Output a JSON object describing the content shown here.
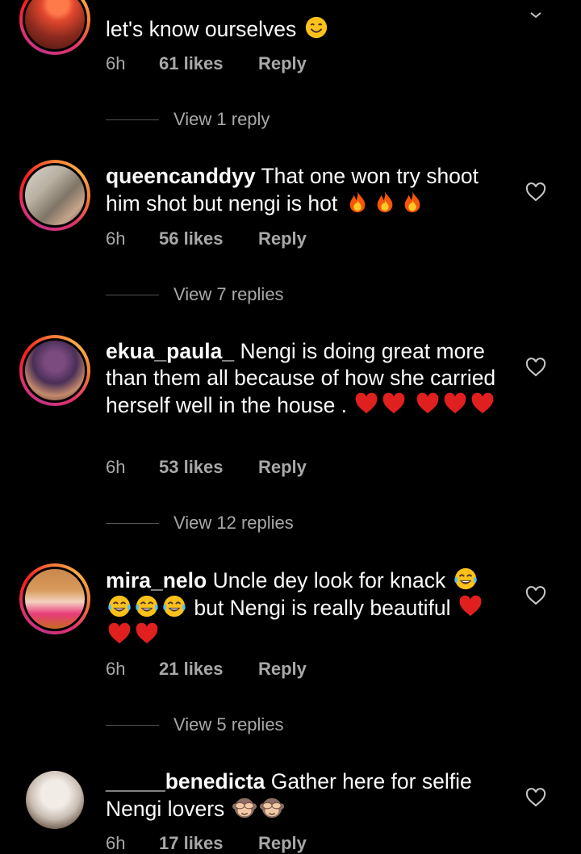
{
  "comments": [
    {
      "user": "",
      "text": "let's know ourselves",
      "emojis": [
        "smiling-face"
      ],
      "time": "6h",
      "likes": "61 likes",
      "reply": "Reply",
      "view_replies": "View 1 reply"
    },
    {
      "user": "queencanddyy",
      "text": "That one won try shoot him shot but nengi is hot",
      "emojis": [
        "fire",
        "fire",
        "fire"
      ],
      "time": "6h",
      "likes": "56 likes",
      "reply": "Reply",
      "view_replies": "View 7 replies"
    },
    {
      "user": "ekua_paula_",
      "text": "Nengi is doing great more than them all because of how she carried herself well in the house .",
      "emojis": [
        "red-heart",
        "red-heart",
        "red-heart",
        "red-heart",
        "red-heart"
      ],
      "time": "6h",
      "likes": "53 likes",
      "reply": "Reply",
      "view_replies": "View 12 replies"
    },
    {
      "user": "mira_nelo",
      "text_a": "Uncle dey look for knack",
      "text_b": "but Nengi is really beautiful",
      "emojis": [
        "joy",
        "joy",
        "joy",
        "joy",
        "red-heart",
        "red-heart",
        "red-heart"
      ],
      "time": "6h",
      "likes": "21 likes",
      "reply": "Reply",
      "view_replies": "View 5 replies"
    },
    {
      "user": "_____benedicta",
      "text": "Gather here for selfie Nengi lovers",
      "emojis": [
        "see-no-evil-monkey",
        "see-no-evil-monkey"
      ],
      "time": "6h",
      "likes": "17 likes",
      "reply": "Reply"
    }
  ],
  "colors": {
    "background": "#000000",
    "text": "#fafafa",
    "meta": "#a8a8a8",
    "heart_red": "#e0201e"
  }
}
